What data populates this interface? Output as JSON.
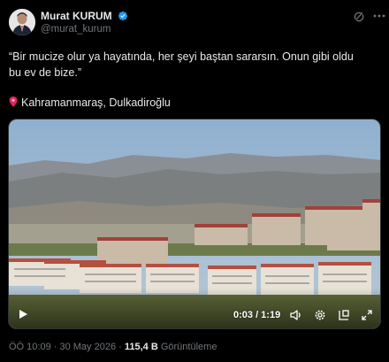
{
  "author": {
    "name": "Murat KURUM",
    "handle": "@murat_kurum",
    "verified": true,
    "verified_color": "#1d9bf0"
  },
  "tweet": {
    "line1": "“Bir mucize olur ya hayatında, her şeyi baştan sararsın. Onun gibi oldu",
    "line2": "bu ev de bize.”",
    "location": "Kahramanmaraş, Dulkadiroğlu"
  },
  "video": {
    "time": "0:03 / 1:19",
    "progress": 0.038
  },
  "meta": {
    "timestamp": "ÖÖ 10:09 · 30 May 2026 ·",
    "views_count": "115,4 B",
    "views_label": "Görüntüleme"
  },
  "icons": {
    "avatar": "avatar",
    "verified": "verified-badge-icon",
    "grok": "grok-icon",
    "more": "more-options-icon",
    "pin": "location-pin-icon",
    "play": "play-icon",
    "volume": "volume-icon",
    "settings": "settings-gear-icon",
    "pip": "picture-in-picture-icon",
    "fullscreen": "fullscreen-icon"
  },
  "colors": {
    "background": "#000000",
    "text": "#e7e9ea",
    "muted": "#71767b",
    "pin": "#e0245e"
  }
}
